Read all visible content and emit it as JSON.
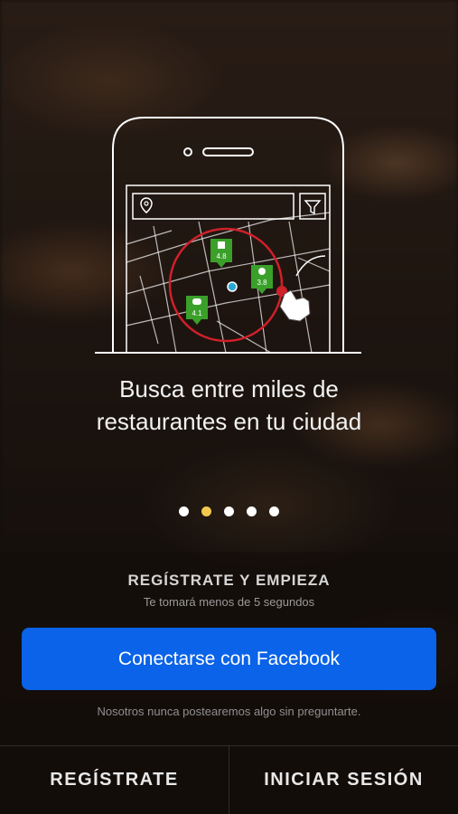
{
  "onboarding": {
    "headline_line1": "Busca entre miles de",
    "headline_line2": "restaurantes en tu ciudad",
    "pager": {
      "count": 5,
      "active_index": 1
    },
    "illustration": {
      "pins": [
        {
          "label": "4.8",
          "icon": "drink-icon"
        },
        {
          "label": "3.8",
          "icon": "chef-hat-icon"
        },
        {
          "label": "4.1",
          "icon": "burger-icon"
        }
      ],
      "accent_red": "#d0202a",
      "pin_green": "#3aa02a",
      "user_dot": "#2aa6d6"
    }
  },
  "signup": {
    "title": "REGÍSTRATE Y EMPIEZA",
    "subtitle": "Te tomará menos de 5 segundos",
    "facebook_button": "Conectarse con Facebook",
    "privacy_note": "Nosotros nunca postearemos algo sin preguntarte."
  },
  "footer": {
    "register_label": "REGÍSTRATE",
    "login_label": "INICIAR SESIÓN"
  },
  "colors": {
    "facebook_blue": "#0a63e8",
    "pager_active": "#f2c94c"
  }
}
